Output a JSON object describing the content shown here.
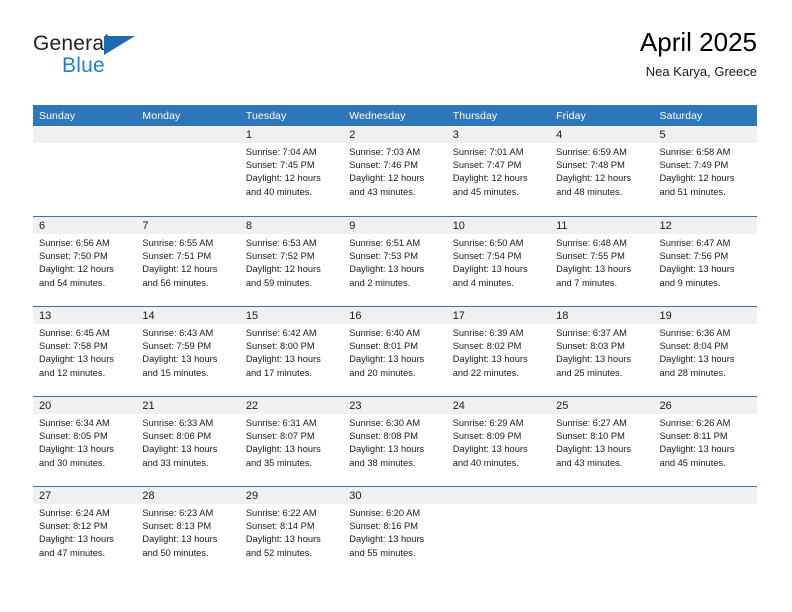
{
  "brand": {
    "name_top": "General",
    "name_bottom": "Blue",
    "triangle_icon": "blue-triangle-logo-icon",
    "color_dark": "#231f20",
    "color_blue": "#1b7fd4",
    "color_triangle": "#1b6cb5"
  },
  "header": {
    "title": "April 2025",
    "subtitle": "Nea Karya, Greece"
  },
  "theme": {
    "header_blue": "#2f77bb",
    "day_band_gray": "#f0f0f0",
    "cell_white": "#ffffff",
    "text_dark": "#1a1a1a"
  },
  "weekdays": [
    "Sunday",
    "Monday",
    "Tuesday",
    "Wednesday",
    "Thursday",
    "Friday",
    "Saturday"
  ],
  "labels": {
    "sunrise_prefix": "Sunrise:",
    "sunset_prefix": "Sunset:",
    "daylight_prefix": "Daylight:"
  },
  "weeks": [
    [
      {
        "day": "",
        "empty": true,
        "lines": []
      },
      {
        "day": "",
        "empty": true,
        "lines": []
      },
      {
        "day": "1",
        "empty": false,
        "lines": [
          "Sunrise: 7:04 AM",
          "Sunset: 7:45 PM",
          "Daylight: 12 hours",
          "and 40 minutes."
        ]
      },
      {
        "day": "2",
        "empty": false,
        "lines": [
          "Sunrise: 7:03 AM",
          "Sunset: 7:46 PM",
          "Daylight: 12 hours",
          "and 43 minutes."
        ]
      },
      {
        "day": "3",
        "empty": false,
        "lines": [
          "Sunrise: 7:01 AM",
          "Sunset: 7:47 PM",
          "Daylight: 12 hours",
          "and 45 minutes."
        ]
      },
      {
        "day": "4",
        "empty": false,
        "lines": [
          "Sunrise: 6:59 AM",
          "Sunset: 7:48 PM",
          "Daylight: 12 hours",
          "and 48 minutes."
        ]
      },
      {
        "day": "5",
        "empty": false,
        "lines": [
          "Sunrise: 6:58 AM",
          "Sunset: 7:49 PM",
          "Daylight: 12 hours",
          "and 51 minutes."
        ]
      }
    ],
    [
      {
        "day": "6",
        "empty": false,
        "lines": [
          "Sunrise: 6:56 AM",
          "Sunset: 7:50 PM",
          "Daylight: 12 hours",
          "and 54 minutes."
        ]
      },
      {
        "day": "7",
        "empty": false,
        "lines": [
          "Sunrise: 6:55 AM",
          "Sunset: 7:51 PM",
          "Daylight: 12 hours",
          "and 56 minutes."
        ]
      },
      {
        "day": "8",
        "empty": false,
        "lines": [
          "Sunrise: 6:53 AM",
          "Sunset: 7:52 PM",
          "Daylight: 12 hours",
          "and 59 minutes."
        ]
      },
      {
        "day": "9",
        "empty": false,
        "lines": [
          "Sunrise: 6:51 AM",
          "Sunset: 7:53 PM",
          "Daylight: 13 hours",
          "and 2 minutes."
        ]
      },
      {
        "day": "10",
        "empty": false,
        "lines": [
          "Sunrise: 6:50 AM",
          "Sunset: 7:54 PM",
          "Daylight: 13 hours",
          "and 4 minutes."
        ]
      },
      {
        "day": "11",
        "empty": false,
        "lines": [
          "Sunrise: 6:48 AM",
          "Sunset: 7:55 PM",
          "Daylight: 13 hours",
          "and 7 minutes."
        ]
      },
      {
        "day": "12",
        "empty": false,
        "lines": [
          "Sunrise: 6:47 AM",
          "Sunset: 7:56 PM",
          "Daylight: 13 hours",
          "and 9 minutes."
        ]
      }
    ],
    [
      {
        "day": "13",
        "empty": false,
        "lines": [
          "Sunrise: 6:45 AM",
          "Sunset: 7:58 PM",
          "Daylight: 13 hours",
          "and 12 minutes."
        ]
      },
      {
        "day": "14",
        "empty": false,
        "lines": [
          "Sunrise: 6:43 AM",
          "Sunset: 7:59 PM",
          "Daylight: 13 hours",
          "and 15 minutes."
        ]
      },
      {
        "day": "15",
        "empty": false,
        "lines": [
          "Sunrise: 6:42 AM",
          "Sunset: 8:00 PM",
          "Daylight: 13 hours",
          "and 17 minutes."
        ]
      },
      {
        "day": "16",
        "empty": false,
        "lines": [
          "Sunrise: 6:40 AM",
          "Sunset: 8:01 PM",
          "Daylight: 13 hours",
          "and 20 minutes."
        ]
      },
      {
        "day": "17",
        "empty": false,
        "lines": [
          "Sunrise: 6:39 AM",
          "Sunset: 8:02 PM",
          "Daylight: 13 hours",
          "and 22 minutes."
        ]
      },
      {
        "day": "18",
        "empty": false,
        "lines": [
          "Sunrise: 6:37 AM",
          "Sunset: 8:03 PM",
          "Daylight: 13 hours",
          "and 25 minutes."
        ]
      },
      {
        "day": "19",
        "empty": false,
        "lines": [
          "Sunrise: 6:36 AM",
          "Sunset: 8:04 PM",
          "Daylight: 13 hours",
          "and 28 minutes."
        ]
      }
    ],
    [
      {
        "day": "20",
        "empty": false,
        "lines": [
          "Sunrise: 6:34 AM",
          "Sunset: 8:05 PM",
          "Daylight: 13 hours",
          "and 30 minutes."
        ]
      },
      {
        "day": "21",
        "empty": false,
        "lines": [
          "Sunrise: 6:33 AM",
          "Sunset: 8:06 PM",
          "Daylight: 13 hours",
          "and 33 minutes."
        ]
      },
      {
        "day": "22",
        "empty": false,
        "lines": [
          "Sunrise: 6:31 AM",
          "Sunset: 8:07 PM",
          "Daylight: 13 hours",
          "and 35 minutes."
        ]
      },
      {
        "day": "23",
        "empty": false,
        "lines": [
          "Sunrise: 6:30 AM",
          "Sunset: 8:08 PM",
          "Daylight: 13 hours",
          "and 38 minutes."
        ]
      },
      {
        "day": "24",
        "empty": false,
        "lines": [
          "Sunrise: 6:29 AM",
          "Sunset: 8:09 PM",
          "Daylight: 13 hours",
          "and 40 minutes."
        ]
      },
      {
        "day": "25",
        "empty": false,
        "lines": [
          "Sunrise: 6:27 AM",
          "Sunset: 8:10 PM",
          "Daylight: 13 hours",
          "and 43 minutes."
        ]
      },
      {
        "day": "26",
        "empty": false,
        "lines": [
          "Sunrise: 6:26 AM",
          "Sunset: 8:11 PM",
          "Daylight: 13 hours",
          "and 45 minutes."
        ]
      }
    ],
    [
      {
        "day": "27",
        "empty": false,
        "lines": [
          "Sunrise: 6:24 AM",
          "Sunset: 8:12 PM",
          "Daylight: 13 hours",
          "and 47 minutes."
        ]
      },
      {
        "day": "28",
        "empty": false,
        "lines": [
          "Sunrise: 6:23 AM",
          "Sunset: 8:13 PM",
          "Daylight: 13 hours",
          "and 50 minutes."
        ]
      },
      {
        "day": "29",
        "empty": false,
        "lines": [
          "Sunrise: 6:22 AM",
          "Sunset: 8:14 PM",
          "Daylight: 13 hours",
          "and 52 minutes."
        ]
      },
      {
        "day": "30",
        "empty": false,
        "lines": [
          "Sunrise: 6:20 AM",
          "Sunset: 8:16 PM",
          "Daylight: 13 hours",
          "and 55 minutes."
        ]
      },
      {
        "day": "",
        "empty": true,
        "lines": []
      },
      {
        "day": "",
        "empty": true,
        "lines": []
      },
      {
        "day": "",
        "empty": true,
        "lines": []
      }
    ]
  ]
}
